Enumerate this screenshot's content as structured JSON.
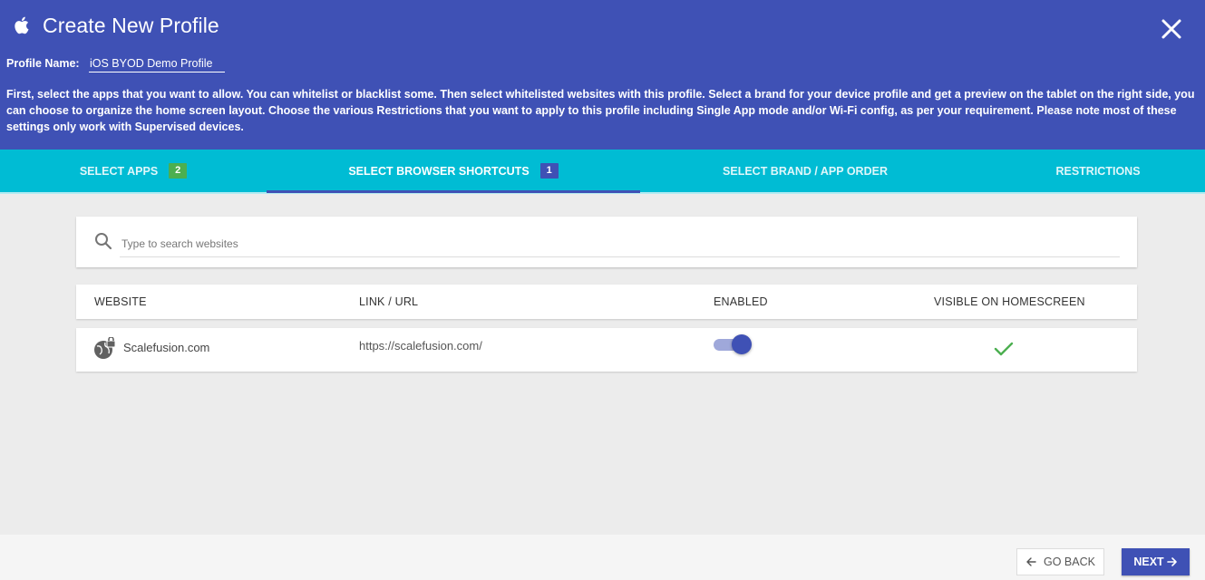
{
  "header": {
    "title": "Create New Profile",
    "profile_name_label": "Profile Name:",
    "profile_name_value": "iOS BYOD Demo Profile",
    "description": "First, select the apps that you want to allow. You can whitelist or blacklist some. Then select whitelisted websites with this profile. Select a brand for your device profile and get a preview on the tablet on the right side, you can choose to organize the home screen layout. Choose the various Restrictions that you want to apply to this profile including Single App mode and/or Wi-Fi config, as per your requirement. Please note most of these settings only work with Supervised devices."
  },
  "tabs": [
    {
      "label": "SELECT APPS",
      "badge": "2",
      "active": false
    },
    {
      "label": "SELECT BROWSER SHORTCUTS",
      "badge": "1",
      "active": true
    },
    {
      "label": "SELECT BRAND / APP ORDER",
      "badge": null,
      "active": false
    },
    {
      "label": "RESTRICTIONS",
      "badge": null,
      "active": false
    }
  ],
  "search": {
    "placeholder": "Type to search websites",
    "value": ""
  },
  "table": {
    "headers": [
      "WEBSITE",
      "LINK / URL",
      "ENABLED",
      "VISIBLE ON HOMESCREEN"
    ],
    "rows": [
      {
        "website": "Scalefusion.com",
        "url": "https://scalefusion.com/",
        "enabled": true,
        "visible_on_homescreen": true
      }
    ]
  },
  "footer": {
    "back_label": "GO BACK",
    "next_label": "NEXT"
  },
  "colors": {
    "primary": "#3f51b5",
    "tab_bar": "#00bcd4",
    "badge_green": "#4caf50",
    "check_green": "#4caf50"
  },
  "icons": {
    "header": "apple-icon",
    "close": "close-icon",
    "search": "search-icon",
    "website": "globe-lock-icon",
    "visible": "check-icon"
  }
}
